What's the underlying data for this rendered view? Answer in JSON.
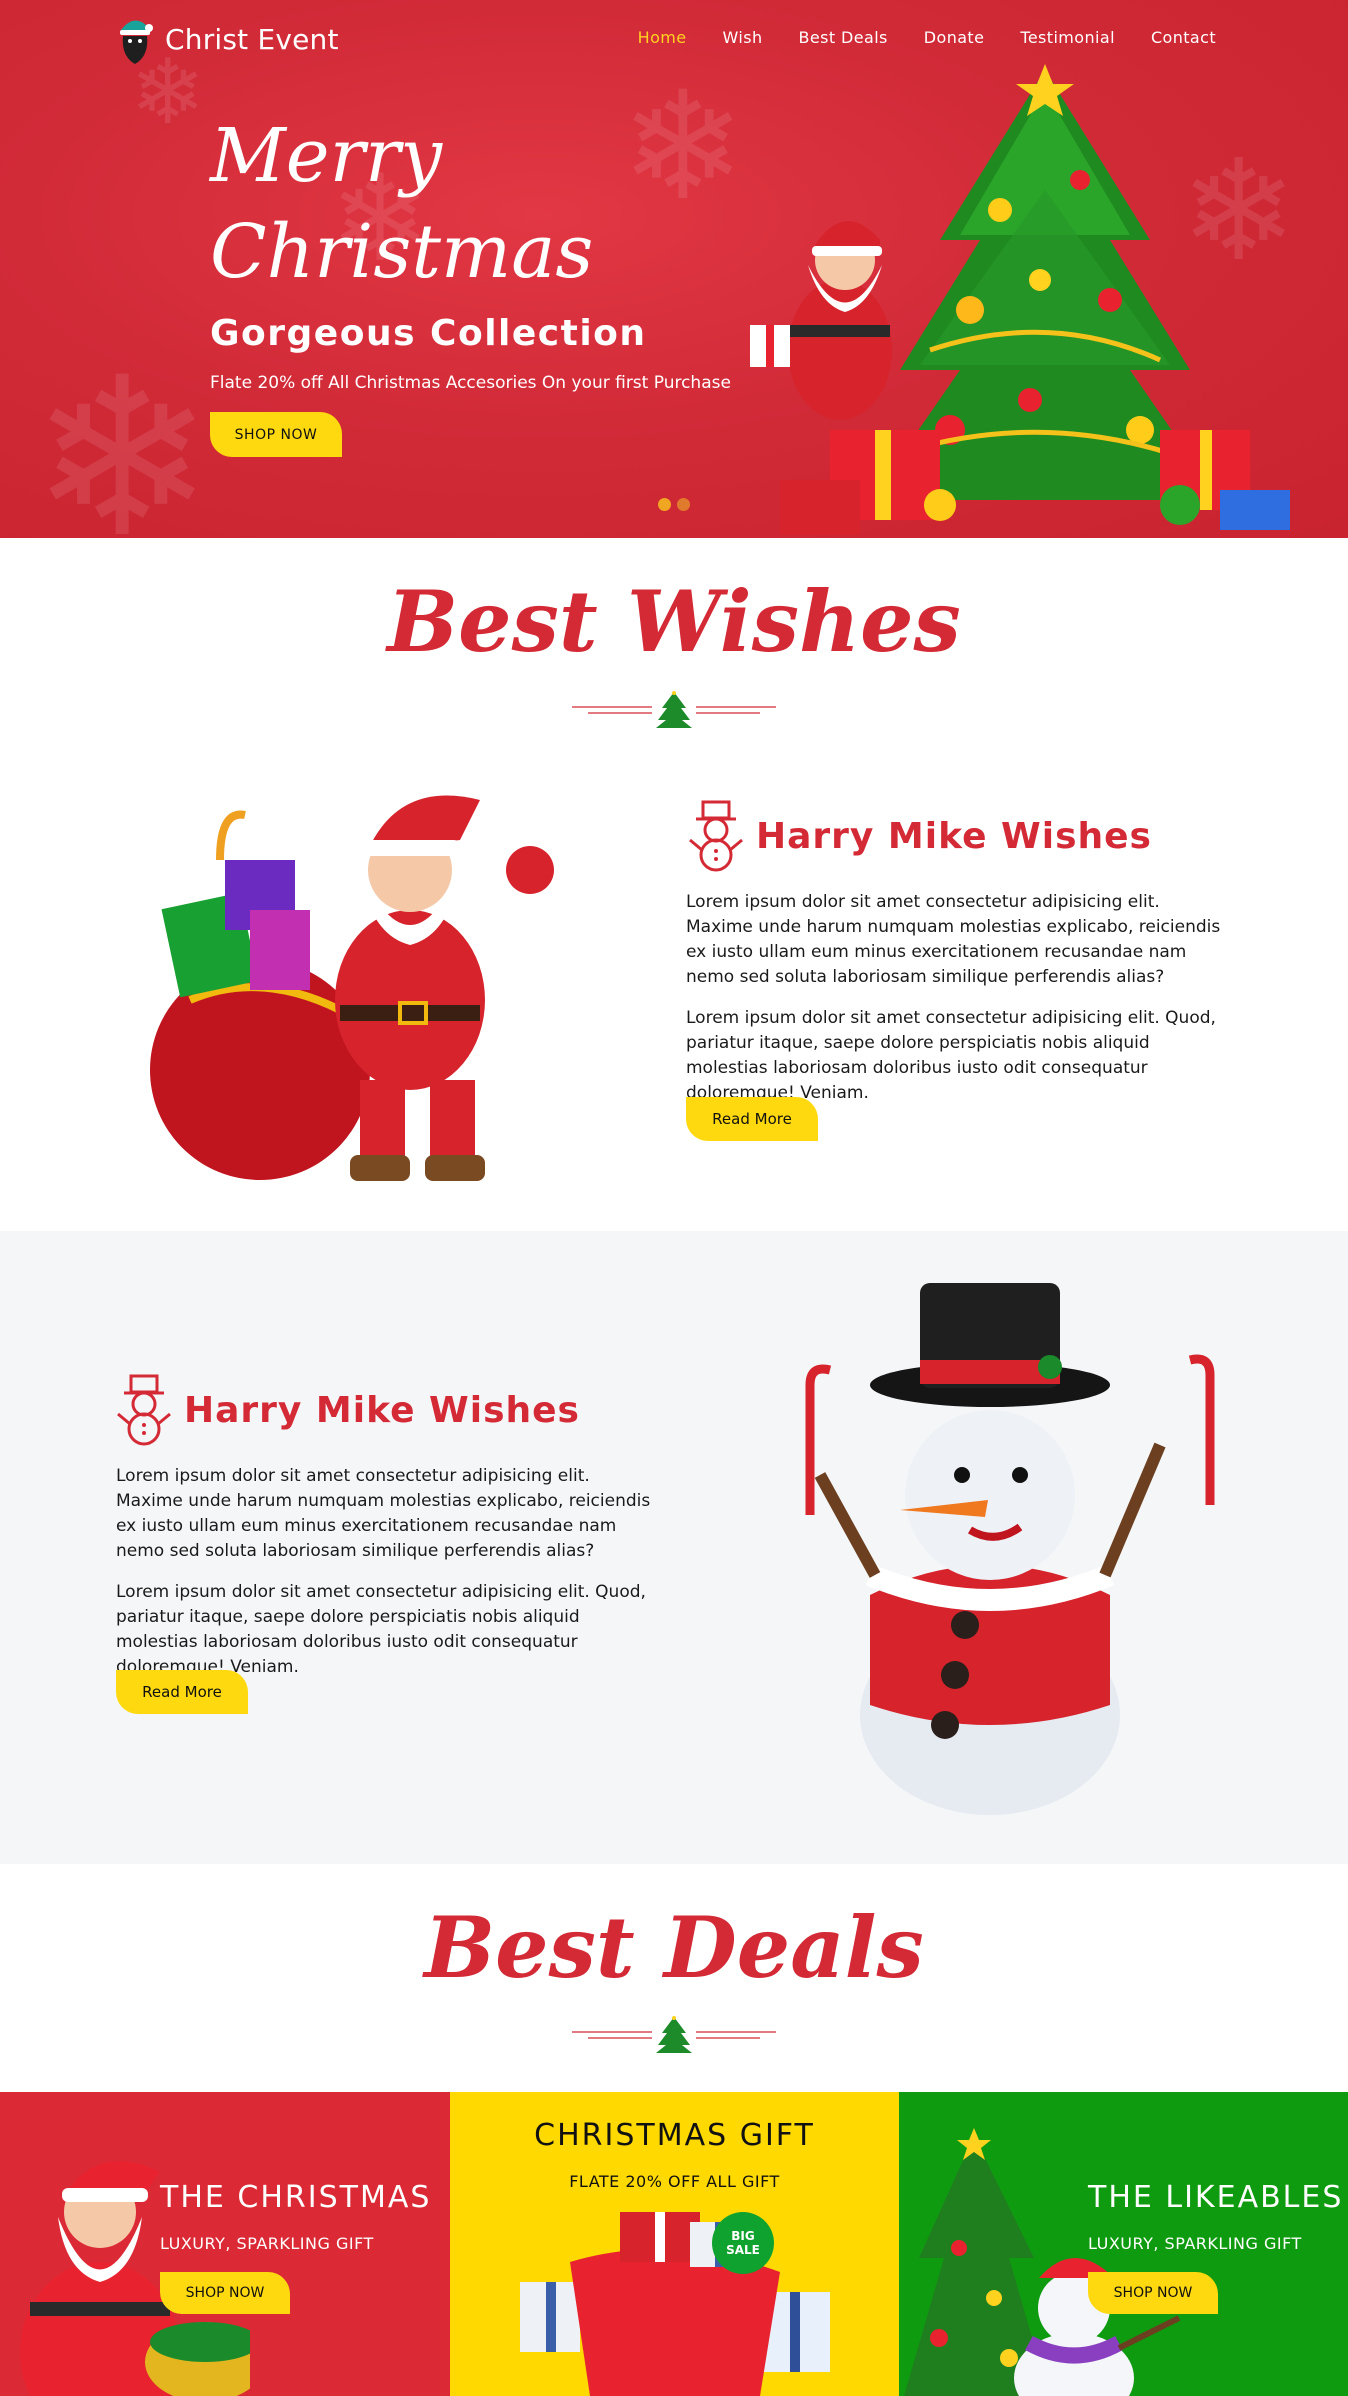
{
  "brand": {
    "name": "Christ Event"
  },
  "nav": {
    "items": [
      "Home",
      "Wish",
      "Best Deals",
      "Donate",
      "Testimonial",
      "Contact"
    ],
    "active_index": 0
  },
  "hero": {
    "script_line1": "Merry",
    "script_line2": "Christmas",
    "title": "Gorgeous Collection",
    "subtitle": "Flate 20% off All Christmas Accesories On your first Purchase",
    "button": "SHOP NOW",
    "slider_dots": 2,
    "active_slide": 1
  },
  "wishes": {
    "heading": "Best Wishes",
    "rows": [
      {
        "title": "Harry Mike Wishes",
        "p1": "Lorem ipsum dolor sit amet consectetur adipisicing elit. Maxime unde harum numquam molestias explicabo, reiciendis ex iusto ullam eum minus exercitationem recusandae nam nemo sed soluta laboriosam similique perferendis alias?",
        "p2": "Lorem ipsum dolor sit amet consectetur adipisicing elit. Quod, pariatur itaque, saepe dolore perspiciatis nobis aliquid molestias laboriosam doloribus iusto odit consequatur doloremque! Veniam.",
        "button": "Read More"
      },
      {
        "title": "Harry Mike Wishes",
        "p1": "Lorem ipsum dolor sit amet consectetur adipisicing elit. Maxime unde harum numquam molestias explicabo, reiciendis ex iusto ullam eum minus exercitationem recusandae nam nemo sed soluta laboriosam similique perferendis alias?",
        "p2": "Lorem ipsum dolor sit amet consectetur adipisicing elit. Quod, pariatur itaque, saepe dolore perspiciatis nobis aliquid molestias laboriosam doloribus iusto odit consequatur doloremque! Veniam.",
        "button": "Read More"
      }
    ]
  },
  "deals": {
    "heading": "Best Deals",
    "cards": [
      {
        "title": "THE CHRISTMAS",
        "subtitle": "LUXURY, SPARKLING GIFT",
        "button": "SHOP NOW"
      },
      {
        "title": "CHRISTMAS GIFT",
        "subtitle": "FLATE 20% OFF ALL GIFT",
        "badge_line1": "BIG",
        "badge_line2": "SALE"
      },
      {
        "title": "THE LIKEABLES",
        "subtitle": "LUXURY, SPARKLING GIFT",
        "button": "SHOP NOW"
      }
    ]
  },
  "colors": {
    "primary_red": "#d42a36",
    "hero_red": "#d22b38",
    "accent_yellow": "#ffd90f",
    "nav_active": "#ffd21f",
    "deal_red": "#db2a36",
    "deal_yellow": "#ffd900",
    "deal_green": "#0f9b0f",
    "section_gray": "#f5f6f8"
  }
}
